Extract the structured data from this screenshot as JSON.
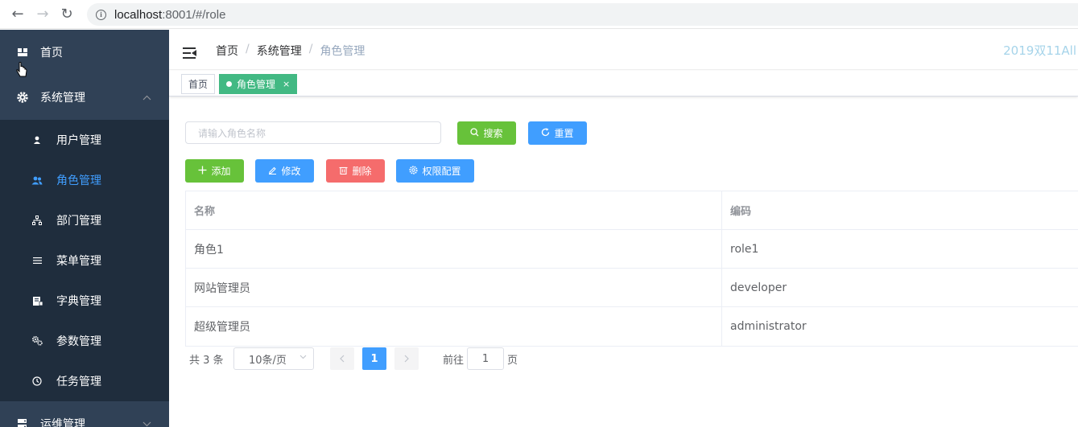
{
  "browser": {
    "url_host": "localhost",
    "url_rest": ":8001/#/role"
  },
  "sidebar": {
    "items": [
      {
        "label": "首页",
        "icon": "dashboard-icon"
      },
      {
        "label": "系统管理",
        "icon": "gear-icon",
        "expanded": true,
        "children": [
          {
            "label": "用户管理",
            "icon": "user-icon"
          },
          {
            "label": "角色管理",
            "icon": "peoples-icon",
            "active": true
          },
          {
            "label": "部门管理",
            "icon": "tree-icon"
          },
          {
            "label": "菜单管理",
            "icon": "list-icon"
          },
          {
            "label": "字典管理",
            "icon": "dictionary-icon"
          },
          {
            "label": "参数管理",
            "icon": "settings-icon"
          },
          {
            "label": "任务管理",
            "icon": "clock-icon"
          }
        ]
      },
      {
        "label": "运维管理",
        "icon": "server-icon",
        "expanded": false
      }
    ]
  },
  "navbar": {
    "breadcrumb": [
      "首页",
      "系统管理",
      "角色管理"
    ],
    "separator": "/",
    "right_text": "2019双11All"
  },
  "tags": {
    "home": "首页",
    "active": "角色管理",
    "close": "×"
  },
  "search": {
    "placeholder": "请输入角色名称",
    "search_label": "搜索",
    "reset_label": "重置"
  },
  "toolbar": {
    "add_label": "添加",
    "edit_label": "修改",
    "delete_label": "删除",
    "perm_label": "权限配置"
  },
  "table": {
    "columns": [
      "名称",
      "编码"
    ],
    "rows": [
      [
        "角色1",
        "role1"
      ],
      [
        "网站管理员",
        "developer"
      ],
      [
        "超级管理员",
        "administrator"
      ]
    ]
  },
  "pagination": {
    "total_text": "共 3 条",
    "page_size": "10条/页",
    "current_page": "1",
    "goto_label": "前往",
    "goto_value": "1",
    "goto_suffix": "页"
  },
  "colors": {
    "sidebar_bg": "#304156",
    "submenu_bg": "#1f2d3d",
    "primary": "#409eff",
    "success": "#67c23a",
    "danger": "#f56c6c",
    "tag_active": "#42b983"
  }
}
